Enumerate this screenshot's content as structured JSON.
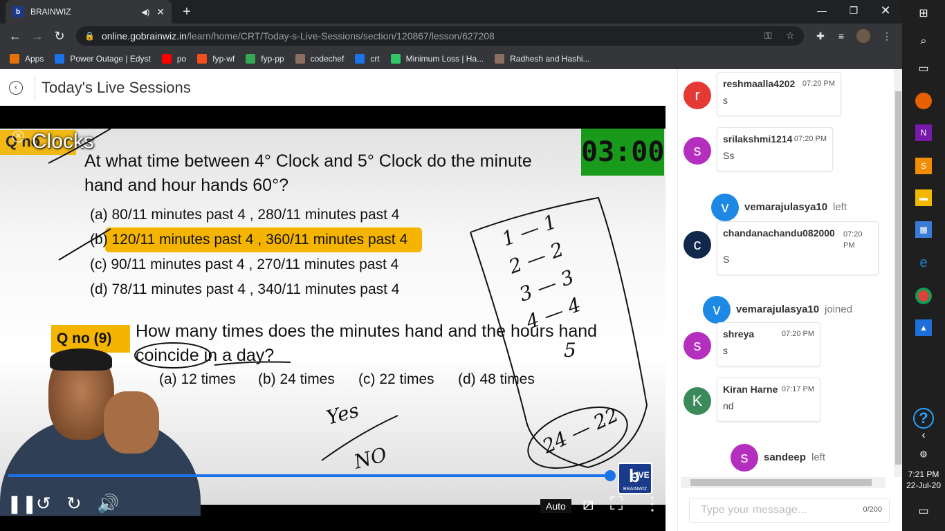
{
  "browser": {
    "tab_title": "BRAINWIZ",
    "tab_audio": "◀)",
    "url_host": "online.gobrainwiz.in",
    "url_path": "/learn/home/CRT/Today-s-Live-Sessions/section/120867/lesson/627208"
  },
  "bookmarks": [
    {
      "label": "Apps",
      "icon": "apps-grid-icon",
      "color": "#e8710a"
    },
    {
      "label": "Power Outage | Edyst",
      "icon": "edyst-icon",
      "color": "#1a73e8"
    },
    {
      "label": "po",
      "icon": "youtube-icon",
      "color": "#ff0000"
    },
    {
      "label": "fyp-wf",
      "icon": "figma-icon",
      "color": "#f24e1e"
    },
    {
      "label": "fyp-pp",
      "icon": "pd-icon",
      "color": "#34a853"
    },
    {
      "label": "codechef",
      "icon": "codechef-icon",
      "color": "#8d6e63"
    },
    {
      "label": "crt",
      "icon": "brainwiz-icon",
      "color": "#1a73e8"
    },
    {
      "label": "Minimum Loss | Ha...",
      "icon": "hackerrank-icon",
      "color": "#2ec866"
    },
    {
      "label": "Radhesh and Hashi...",
      "icon": "codechef-icon",
      "color": "#8d6e63"
    }
  ],
  "page": {
    "title": "Today's Live Sessions"
  },
  "video": {
    "overlay_title": "Clocks",
    "timer": "03:00",
    "q1_tag": "Q no",
    "q1_text_line1": "At what time between 4° Clock and 5° Clock do the minute",
    "q1_text_line2": "hand and hour hands 60°?",
    "q1_options": [
      "(a) 80/11 minutes past 4 , 280/11 minutes past 4",
      "(b) 120/11 minutes past 4 , 360/11 minutes past 4",
      "(c) 90/11 minutes past 4 , 270/11 minutes past 4",
      "(d) 78/11 minutes past 4 , 340/11 minutes past 4"
    ],
    "q2_tag": "Q no (9)",
    "q2_text_line1": "How many times does the minutes hand and the hours hand",
    "q2_text_line2": "coincide in a day?",
    "q2_options": [
      "(a) 12 times",
      "(b) 24 times",
      "(c) 22 times",
      "(d) 48 times"
    ],
    "live_label": "LIVE",
    "quality_label": "Auto",
    "logo_text": "BRAINWIZ",
    "progress": 1.0,
    "handwriting": {
      "yes": "Yes",
      "no": "NO",
      "list": [
        "1 — 1",
        "2 — 2",
        "3 — 3",
        "4 — 4",
        "5",
        "24 — 22"
      ]
    }
  },
  "chat": {
    "messages": [
      {
        "type": "msg",
        "initial": "r",
        "user": "reshmaalla4202",
        "time": "07:20 PM",
        "text": "s",
        "color": "#e53935"
      },
      {
        "type": "msg",
        "initial": "s",
        "user": "srilakshmi1214",
        "time": "07:20 PM",
        "text": "Ss",
        "color": "#b52fbf"
      },
      {
        "type": "sys",
        "initial": "v",
        "user": "vemarajulasya10",
        "action": "left",
        "color": "#1e88e5"
      },
      {
        "type": "msg",
        "initial": "c",
        "user": "chandanachandu082000",
        "time": "07:20 PM",
        "text": "S",
        "color": "#12284a"
      },
      {
        "type": "sys",
        "initial": "v",
        "user": "vemarajulasya10",
        "action": "joined",
        "color": "#1e88e5"
      },
      {
        "type": "msg",
        "initial": "s",
        "user": "shreya",
        "time": "07:20 PM",
        "text": "s",
        "color": "#b52fbf"
      },
      {
        "type": "msg",
        "initial": "K",
        "user": "Kiran Harne",
        "time": "07:17 PM",
        "text": "nd",
        "color": "#3a8a5a"
      },
      {
        "type": "sys",
        "initial": "s",
        "user": "sandeep",
        "action": "left",
        "color": "#b52fbf"
      }
    ],
    "input_placeholder": "Type your message...",
    "counter": "0/200"
  },
  "taskbar": {
    "time": "7:21 PM",
    "date": "22-Jul-20"
  }
}
